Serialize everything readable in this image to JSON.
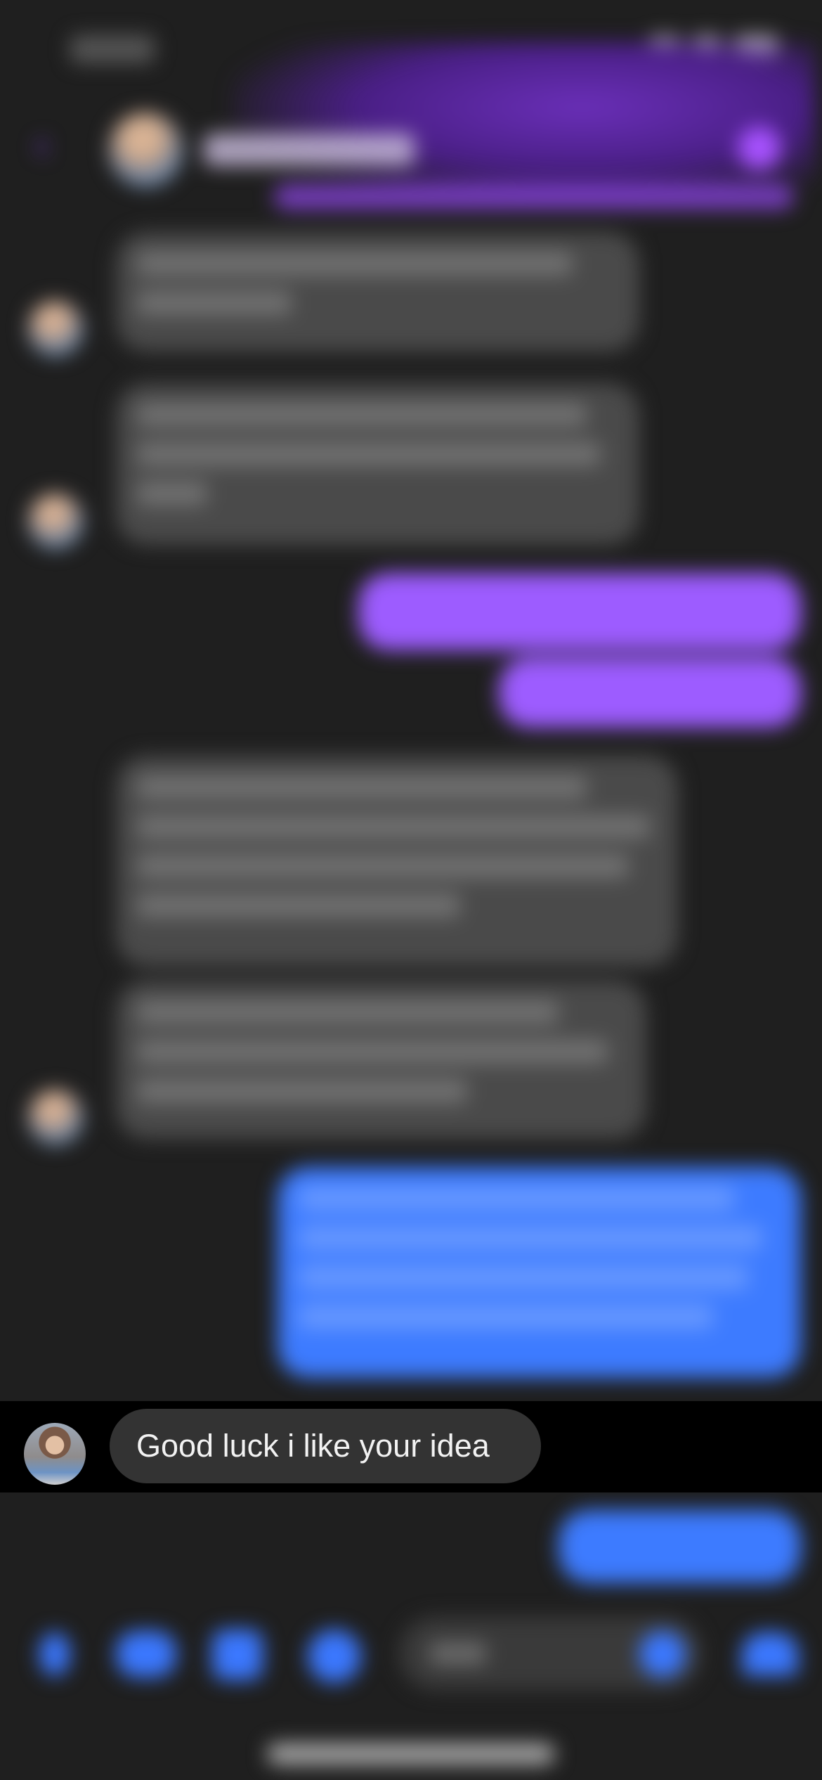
{
  "focused_message": {
    "text": "Good luck i like your idea",
    "sender_avatar": "avatar"
  },
  "colors": {
    "background": "#1f1f1f",
    "focus_band": "#000000",
    "incoming_bubble": "#333333",
    "outgoing_purple": "#9d5cff",
    "outgoing_blue": "#3d7bff",
    "accent": "#3b78ff"
  },
  "icons": {
    "back": "chevron-left-icon",
    "header_action": "call-icon",
    "composer": [
      "plus-icon",
      "camera-icon",
      "photo-icon",
      "microphone-icon",
      "emoji-icon",
      "like-icon"
    ]
  }
}
